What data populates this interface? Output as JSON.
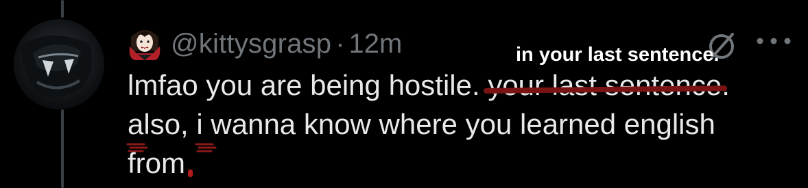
{
  "tweet": {
    "handle": "@kittysgrasp",
    "separator": "·",
    "time": "12m",
    "text": {
      "line1_start": "lmfao you are being hostile. ",
      "line1_struck": "your last sentence",
      "line1_end": ".",
      "line2_part1": "",
      "line2_a": "a",
      "line2_part2": "lso, ",
      "line2_i": "i",
      "line2_part3": " wanna know where you learned english",
      "line3": "from"
    },
    "annotation": "in your last sentence."
  },
  "icons": {
    "emoji": "vampire-woman-emoji",
    "grok": "grok-icon",
    "more": "more-icon"
  },
  "colors": {
    "background": "#000000",
    "text": "#e7e9ea",
    "secondary": "#71767b",
    "markup_red": "#8a1a1a"
  }
}
